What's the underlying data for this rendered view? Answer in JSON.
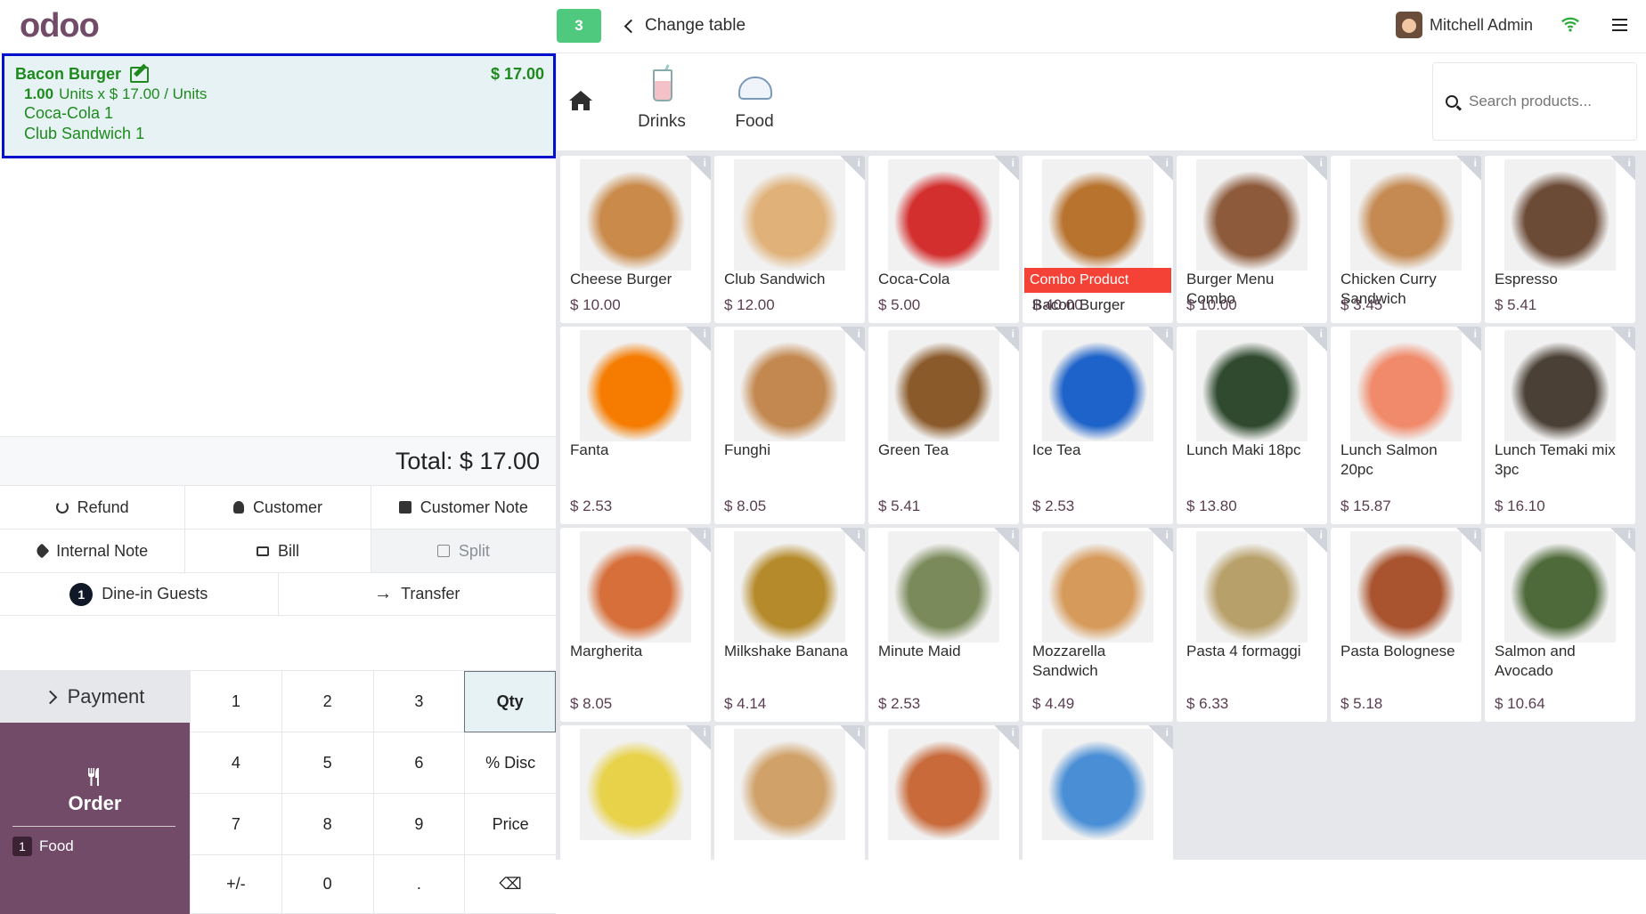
{
  "header": {
    "logo": "odoo",
    "table_number": "3",
    "change_table": "Change table",
    "user_name": "Mitchell Admin"
  },
  "order": {
    "line": {
      "name": "Bacon Burger",
      "price": "$ 17.00",
      "qty": "1.00",
      "unit_info": "Units x $ 17.00 / Units",
      "sub_items": [
        "Coca-Cola 1",
        "Club Sandwich 1"
      ]
    },
    "total": "Total: $ 17.00"
  },
  "controls": {
    "refund": "Refund",
    "customer": "Customer",
    "customer_note": "Customer Note",
    "internal_note": "Internal Note",
    "bill": "Bill",
    "split": "Split",
    "guests_count": "1",
    "dine_in": "Dine-in Guests",
    "transfer": "Transfer",
    "payment": "Payment",
    "order": "Order",
    "order_food_count": "1",
    "order_food": "Food"
  },
  "numpad": [
    "1",
    "2",
    "3",
    "Qty",
    "4",
    "5",
    "6",
    "% Disc",
    "7",
    "8",
    "9",
    "Price",
    "+/-",
    "0",
    ".",
    "⌫"
  ],
  "categories": {
    "drinks": "Drinks",
    "food": "Food"
  },
  "search": {
    "placeholder": "Search products..."
  },
  "products": [
    {
      "name": "Cheese Burger",
      "price": "$ 10.00",
      "color": "#c98a4a"
    },
    {
      "name": "Club Sandwich",
      "price": "$ 12.00",
      "color": "#e0b27a"
    },
    {
      "name": "Coca-Cola",
      "price": "$ 5.00",
      "color": "#d32f2f"
    },
    {
      "name": "Bacon Burger",
      "price": "$ 40.00",
      "color": "#b8732f",
      "tag": "Combo Product"
    },
    {
      "name": "Burger Menu Combo",
      "price": "$ 10.00",
      "color": "#8d5a3b"
    },
    {
      "name": "Chicken Curry Sandwich",
      "price": "$ 3.45",
      "color": "#c48a52"
    },
    {
      "name": "Espresso",
      "price": "$ 5.41",
      "color": "#6b4a36"
    },
    {
      "name": "Fanta",
      "price": "$ 2.53",
      "color": "#f57c00"
    },
    {
      "name": "Funghi",
      "price": "$ 8.05",
      "color": "#c2884f"
    },
    {
      "name": "Green Tea",
      "price": "$ 5.41",
      "color": "#8a5a2a"
    },
    {
      "name": "Ice Tea",
      "price": "$ 2.53",
      "color": "#1e63c9"
    },
    {
      "name": "Lunch Maki 18pc",
      "price": "$ 13.80",
      "color": "#2f4a2f"
    },
    {
      "name": "Lunch Salmon 20pc",
      "price": "$ 15.87",
      "color": "#f08a6a"
    },
    {
      "name": "Lunch Temaki mix 3pc",
      "price": "$ 16.10",
      "color": "#4a4035"
    },
    {
      "name": "Margherita",
      "price": "$ 8.05",
      "color": "#d66f3a"
    },
    {
      "name": "Milkshake Banana",
      "price": "$ 4.14",
      "color": "#b58a2a"
    },
    {
      "name": "Minute Maid",
      "price": "$ 2.53",
      "color": "#7a8a5a"
    },
    {
      "name": "Mozzarella Sandwich",
      "price": "$ 4.49",
      "color": "#d69a5a"
    },
    {
      "name": "Pasta 4 formaggi",
      "price": "$ 6.33",
      "color": "#b8a06a"
    },
    {
      "name": "Pasta Bolognese",
      "price": "$ 5.18",
      "color": "#a9542f"
    },
    {
      "name": "Salmon and Avocado",
      "price": "$ 10.64",
      "color": "#4f6a3a"
    },
    {
      "name": "",
      "price": "",
      "color": "#e8d24a"
    },
    {
      "name": "",
      "price": "",
      "color": "#d0a26a"
    },
    {
      "name": "",
      "price": "",
      "color": "#c86a3a"
    },
    {
      "name": "",
      "price": "",
      "color": "#4a8fd6"
    }
  ]
}
